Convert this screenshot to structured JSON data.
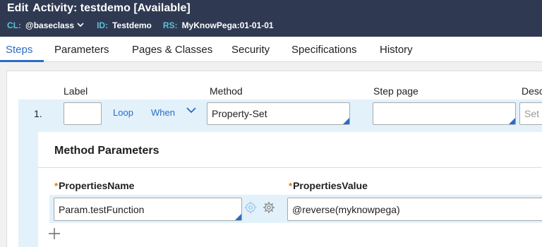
{
  "header": {
    "mode": "Edit",
    "title": "Activity: testdemo [Available]",
    "cl_key": "CL:",
    "cl_value": "@baseclass",
    "id_key": "ID:",
    "id_value": "Testdemo",
    "rs_key": "RS:",
    "rs_value": "MyKnowPega:01-01-01"
  },
  "tabs": [
    {
      "label": "Steps",
      "active": true
    },
    {
      "label": "Parameters",
      "active": false
    },
    {
      "label": "Pages & Classes",
      "active": false
    },
    {
      "label": "Security",
      "active": false
    },
    {
      "label": "Specifications",
      "active": false
    },
    {
      "label": "History",
      "active": false
    }
  ],
  "columns": {
    "label": "Label",
    "method": "Method",
    "step_page": "Step page",
    "description": "Desc"
  },
  "step": {
    "number": "1.",
    "label_value": "",
    "loop": "Loop",
    "when": "When",
    "method_value": "Property-Set",
    "step_page_value": "",
    "description_placeholder": "Set"
  },
  "method_parameters": {
    "title": "Method Parameters",
    "required_mark": "*",
    "col_name": "PropertiesName",
    "col_value": "PropertiesValue",
    "rows": [
      {
        "name": "Param.testFunction",
        "value": "@reverse(myknowpega)"
      }
    ],
    "add": "+"
  },
  "icons": {
    "target": "target-icon",
    "gear": "gear-icon",
    "chevron": "chevron-down-icon",
    "plus": "plus-icon"
  },
  "colors": {
    "header_bg": "#2f3a52",
    "accent": "#2a6cc7",
    "meta_key": "#5cc2d6",
    "row_highlight": "#e3f1fb",
    "required": "#e07a00"
  }
}
